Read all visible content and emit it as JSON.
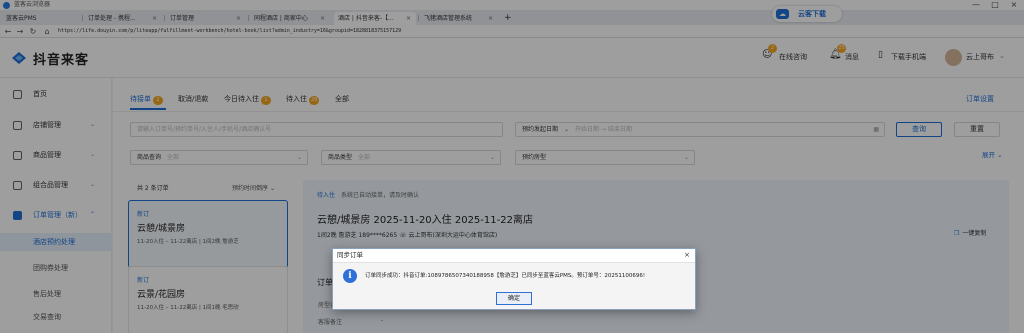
{
  "browser": {
    "window_title": "蓝客云浏览器",
    "tabs": [
      {
        "label": "蓝客云PMS",
        "close": ""
      },
      {
        "label": "订单处理 - 携程...",
        "close": "×"
      },
      {
        "label": "订单管理",
        "close": "×"
      },
      {
        "label": "同程酒店 | 商家中心",
        "close": "×"
      },
      {
        "label": "酒店 | 抖音来客-【...",
        "close": "×"
      },
      {
        "label": "飞猪酒店管理系统",
        "close": "×"
      }
    ],
    "new_tab": "+",
    "url": "https://life.douyin.com/p/liteapp/fulfillment-workbench/hotel-book/list?admin_industry=16&groupid=1828818375157129",
    "cloud_button": "云客下载",
    "window_controls": {
      "min": "—",
      "max": "□",
      "close": "×"
    }
  },
  "header": {
    "logo": "抖音来客",
    "consult": "在线咨询",
    "consult_badge": "2",
    "messages": "消息",
    "messages_badge": "25",
    "download": "下载手机端",
    "user": "云上哥布"
  },
  "sidebar": {
    "items": [
      {
        "label": "首页",
        "chevron": ""
      },
      {
        "label": "店铺管理",
        "chevron": "⌄"
      },
      {
        "label": "商品管理",
        "chevron": "⌄"
      },
      {
        "label": "组合品管理",
        "chevron": "⌄"
      },
      {
        "label": "订单管理（新）",
        "chevron": "⌃"
      }
    ],
    "subitems": [
      "酒店预约处理",
      "团购券处理",
      "售后处理",
      "交易查询"
    ]
  },
  "tabs": [
    {
      "label": "待接单",
      "count": "2"
    },
    {
      "label": "取消/退款",
      "count": ""
    },
    {
      "label": "今日待入住",
      "count": "1"
    },
    {
      "label": "待入住",
      "count": "29"
    },
    {
      "label": "全部",
      "count": ""
    }
  ],
  "order_settings": "订单设置",
  "filters": {
    "search_placeholder": "请输入订单号/预约单号/入住人/手机号/酒店确认号",
    "date_label": "预约发起日期",
    "date_start": "开始日期",
    "date_sep": "→",
    "date_end": "结束日期",
    "query": "查询",
    "reset": "重置",
    "product_search_label": "商品查询",
    "product_type_label": "商品类型",
    "room_type_label": "预约房型",
    "all": "全部",
    "collapse": "展开 ⌄"
  },
  "list": {
    "count_text": "共 2 条订单",
    "sort_text": "预约时间倒序 ⌄",
    "cards": [
      {
        "tag": "新订",
        "room": "云憩/城景房",
        "meta": "11-20入住 – 11-22离店  | 1间2晚  詹游芝"
      },
      {
        "tag": "新订",
        "room": "云景/花园房",
        "meta": "11-20入住 – 11-22离店  | 1间1晚  毛思欣"
      }
    ]
  },
  "detail": {
    "status": "待入住",
    "status_note": "系统已自动接单，请及时确认",
    "title": "云憩/城景房    2025-11-20入住 2025-11-22离店",
    "info": "1间2晚    詹游芝 189****6265 ☏    云上哥布(深圳大运中心体育馆店)",
    "copy": "一键复制",
    "section": "订单",
    "row1": "房型名",
    "row2": "客服备注",
    "row2_value": "-"
  },
  "dialog": {
    "title": "同步订单",
    "close": "×",
    "icon": "i",
    "message": "订单同步成功：抖音订单:1089786507340188958【詹游芝】已同步至蓝客云PMS。预订单号：20251100696!",
    "ok": "确定"
  }
}
